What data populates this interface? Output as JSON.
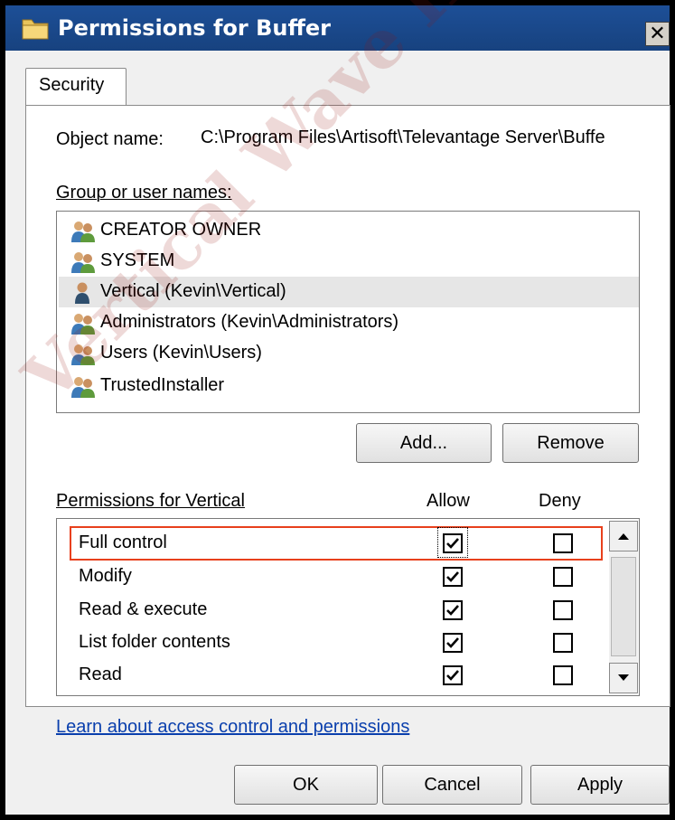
{
  "window": {
    "title": "Permissions for Buffer",
    "close_symbol": "✕"
  },
  "tabs": [
    {
      "label": "Security",
      "active": true
    }
  ],
  "object": {
    "label": "Object name:",
    "value": "C:\\Program Files\\Artisoft\\Televantage Server\\Buffe"
  },
  "users": {
    "label": "Group or user names:",
    "items": [
      {
        "name": "CREATOR OWNER",
        "icon": "group-icon",
        "selected": false
      },
      {
        "name": "SYSTEM",
        "icon": "group-icon",
        "selected": false
      },
      {
        "name": "Vertical (Kevin\\Vertical)",
        "icon": "user-icon",
        "selected": true
      },
      {
        "name": "Administrators (Kevin\\Administrators)",
        "icon": "group-icon",
        "selected": false
      },
      {
        "name": "Users (Kevin\\Users)",
        "icon": "group-icon",
        "selected": false
      },
      {
        "name": "TrustedInstaller",
        "icon": "group-icon",
        "selected": false
      }
    ]
  },
  "buttons": {
    "add": "Add...",
    "remove": "Remove",
    "ok": "OK",
    "cancel": "Cancel",
    "apply": "Apply"
  },
  "permissions": {
    "label": "Permissions for Vertical",
    "allow_header": "Allow",
    "deny_header": "Deny",
    "items": [
      {
        "name": "Full control",
        "allow": true,
        "deny": false,
        "highlighted": true
      },
      {
        "name": "Modify",
        "allow": true,
        "deny": false,
        "highlighted": false
      },
      {
        "name": "Read & execute",
        "allow": true,
        "deny": false,
        "highlighted": false
      },
      {
        "name": "List folder contents",
        "allow": true,
        "deny": false,
        "highlighted": false
      },
      {
        "name": "Read",
        "allow": true,
        "deny": false,
        "highlighted": false
      }
    ]
  },
  "link": {
    "text": "Learn about access control and permissions"
  },
  "watermark": {
    "text": "Vertical Wave IP Knowledge"
  },
  "colors": {
    "title_bar": "#1d4f97",
    "highlight_border": "#e8401c",
    "link": "#0a3fad",
    "selected_row": "#e6e6e6"
  }
}
